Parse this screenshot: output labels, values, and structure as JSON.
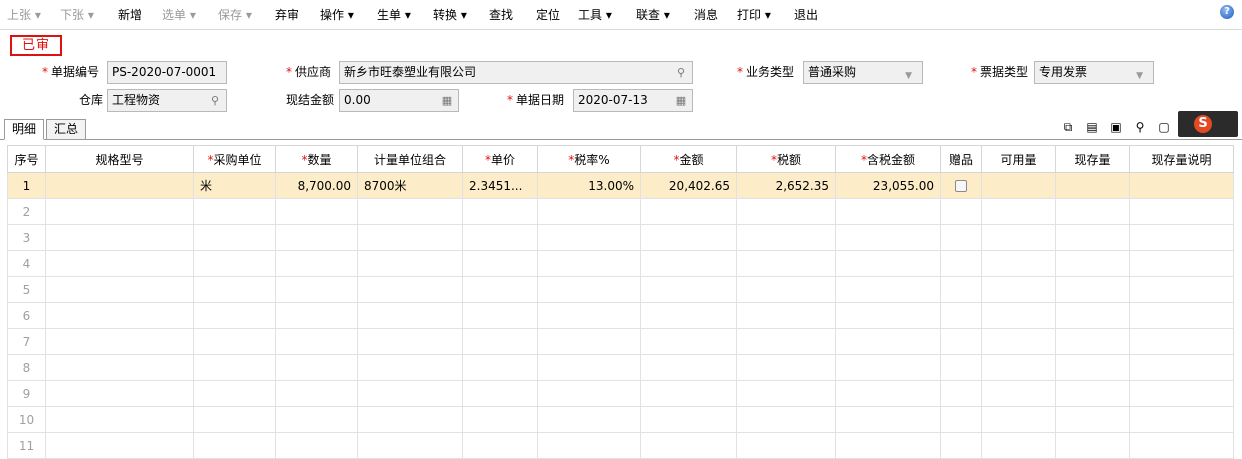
{
  "toolbar": {
    "items": [
      {
        "label": "上张 ▾",
        "disabled": true
      },
      {
        "label": "下张 ▾",
        "disabled": true
      },
      {
        "label": "新增",
        "disabled": false
      },
      {
        "label": "选单 ▾",
        "disabled": true
      },
      {
        "label": "保存 ▾",
        "disabled": true
      },
      {
        "label": "弃审",
        "disabled": false
      },
      {
        "label": "操作 ▾",
        "disabled": false
      },
      {
        "label": "生单 ▾",
        "disabled": false
      },
      {
        "label": "转换 ▾",
        "disabled": false
      },
      {
        "label": "查找",
        "disabled": false
      },
      {
        "label": "定位",
        "disabled": false
      },
      {
        "label": "工具 ▾",
        "disabled": false
      },
      {
        "label": "联查 ▾",
        "disabled": false
      },
      {
        "label": "消息",
        "disabled": false
      },
      {
        "label": "打印 ▾",
        "disabled": false
      },
      {
        "label": "退出",
        "disabled": false
      }
    ],
    "help_glyph": "?"
  },
  "status_badge": "已审",
  "form": {
    "doc_no_label": "单据编号",
    "doc_no_value": "PS-2020-07-0001",
    "supplier_label": "供应商",
    "supplier_value": "新乡市旺泰塑业有限公司",
    "biz_type_label": "业务类型",
    "biz_type_value": "普通采购",
    "invoice_type_label": "票据类型",
    "invoice_type_value": "专用发票",
    "warehouse_label": "仓库",
    "warehouse_value": "工程物资",
    "settle_amount_label": "现结金额",
    "settle_amount_value": "0.00",
    "doc_date_label": "单据日期",
    "doc_date_value": "2020-07-13",
    "required_mark": "*"
  },
  "tabs": [
    {
      "label": "明细",
      "active": true
    },
    {
      "label": "汇总",
      "active": false
    }
  ],
  "table": {
    "columns": [
      {
        "label": "序号",
        "required": false
      },
      {
        "label": "规格型号",
        "required": false
      },
      {
        "label": "采购单位",
        "required": true
      },
      {
        "label": "数量",
        "required": true
      },
      {
        "label": "计量单位组合",
        "required": false
      },
      {
        "label": "单价",
        "required": true
      },
      {
        "label": "税率%",
        "required": true
      },
      {
        "label": "金额",
        "required": true
      },
      {
        "label": "税额",
        "required": true
      },
      {
        "label": "含税金额",
        "required": true
      },
      {
        "label": "赠品",
        "required": false
      },
      {
        "label": "可用量",
        "required": false
      },
      {
        "label": "现存量",
        "required": false
      },
      {
        "label": "现存量说明",
        "required": false
      }
    ],
    "rows": [
      {
        "no": "1",
        "spec": "",
        "unit": "米",
        "qty": "8,700.00",
        "unit_group": "8700米",
        "price": "2.3451...",
        "tax_rate": "13.00%",
        "amount": "20,402.65",
        "tax": "2,652.35",
        "amount_with_tax": "23,055.00",
        "gift": false,
        "available": "",
        "stock": "",
        "stock_note": ""
      },
      {
        "no": "2"
      },
      {
        "no": "3"
      },
      {
        "no": "4"
      },
      {
        "no": "5"
      },
      {
        "no": "6"
      },
      {
        "no": "7"
      },
      {
        "no": "8"
      },
      {
        "no": "9"
      },
      {
        "no": "10"
      },
      {
        "no": "11"
      }
    ]
  },
  "colors": {
    "accent_red": "#e01010",
    "selected_row": "#fdecc8"
  }
}
